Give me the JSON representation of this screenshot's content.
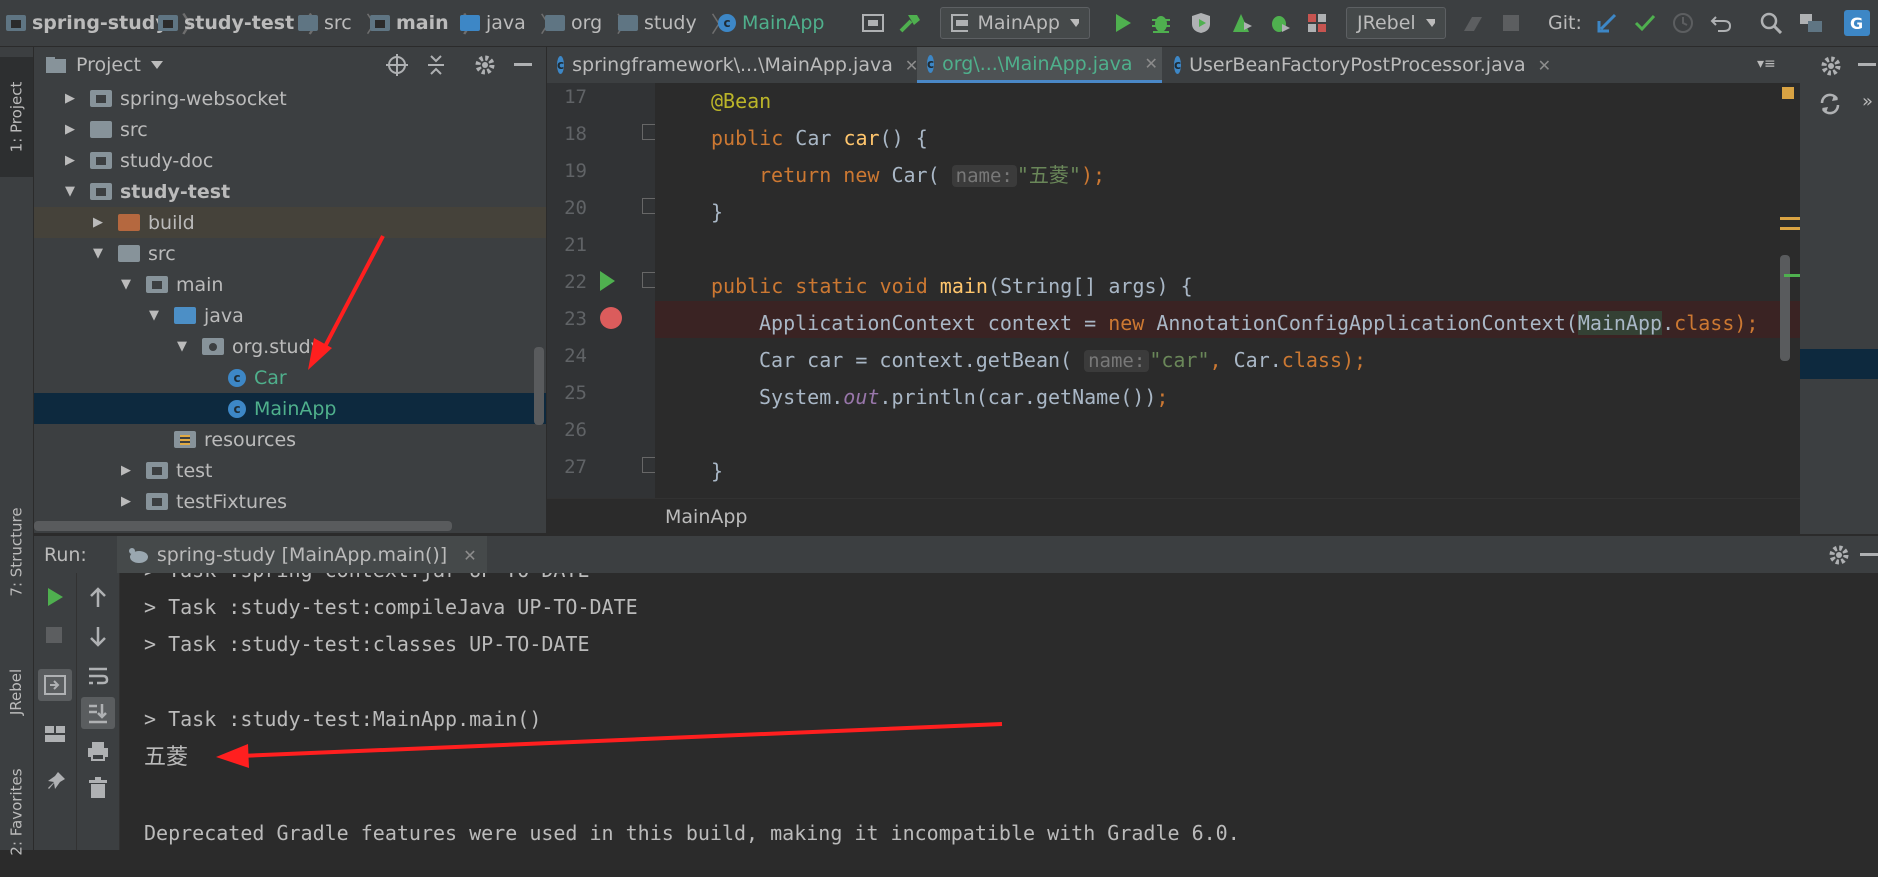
{
  "breadcrumbs": [
    "spring-study",
    "study-test",
    "src",
    "main",
    "java",
    "org",
    "study",
    "MainApp"
  ],
  "toolbar": {
    "run_config": "MainApp",
    "jrebel_label": "JRebel",
    "git_label": "Git:"
  },
  "project_panel": {
    "title": "Project",
    "tree": [
      {
        "label": "spring-websocket",
        "depth": 1,
        "expanded": false,
        "icon": "module-folder"
      },
      {
        "label": "src",
        "depth": 1,
        "expanded": false,
        "icon": "folder"
      },
      {
        "label": "study-doc",
        "depth": 1,
        "expanded": false,
        "icon": "module-folder"
      },
      {
        "label": "study-test",
        "depth": 1,
        "expanded": true,
        "icon": "module-folder"
      },
      {
        "label": "build",
        "depth": 2,
        "expanded": false,
        "icon": "excluded-folder"
      },
      {
        "label": "src",
        "depth": 2,
        "expanded": true,
        "icon": "folder"
      },
      {
        "label": "main",
        "depth": 3,
        "expanded": true,
        "icon": "module-folder"
      },
      {
        "label": "java",
        "depth": 4,
        "expanded": true,
        "icon": "source-folder"
      },
      {
        "label": "org.study",
        "depth": 5,
        "expanded": true,
        "icon": "package"
      },
      {
        "label": "Car",
        "depth": 6,
        "icon": "class"
      },
      {
        "label": "MainApp",
        "depth": 6,
        "icon": "class",
        "selected": true
      },
      {
        "label": "resources",
        "depth": 4,
        "icon": "resources-folder"
      },
      {
        "label": "test",
        "depth": 3,
        "expanded": false,
        "icon": "module-folder"
      },
      {
        "label": "testFixtures",
        "depth": 3,
        "expanded": false,
        "icon": "module-folder"
      }
    ]
  },
  "editor": {
    "tabs": [
      {
        "label": "springframework\\...\\MainApp.java",
        "active": false
      },
      {
        "label": "org\\...\\MainApp.java",
        "active": true
      },
      {
        "label": "UserBeanFactoryPostProcessor.java",
        "active": false
      }
    ],
    "line_numbers": [
      "17",
      "18",
      "19",
      "20",
      "21",
      "22",
      "23",
      "24",
      "25",
      "26",
      "27"
    ],
    "breadcrumb": "MainApp",
    "hint_name": "name:",
    "str_wuling": "\"五菱\"",
    "str_car": "\"car\""
  },
  "run_panel": {
    "label": "Run:",
    "tab_label": "spring-study [MainApp.main()]",
    "console_lines": [
      "> Task :spring-context:jar UP-TO-DATE",
      "> Task :study-test:compileJava UP-TO-DATE",
      "> Task :study-test:classes UP-TO-DATE",
      "",
      "> Task :study-test:MainApp.main()",
      "五菱",
      "",
      "Deprecated Gradle features were used in this build, making it incompatible with Gradle 6.0."
    ]
  },
  "side_tabs": {
    "project": "1: Project",
    "structure": "7: Structure",
    "jrebel": "JRebel",
    "favorites": "2: Favorites"
  },
  "colors": {
    "background": "#2b2b2b",
    "panel": "#3c3f41",
    "selection": "#0d293e",
    "annotation_arrow": "#ff1f1f",
    "class_green": "#4fb08c"
  }
}
